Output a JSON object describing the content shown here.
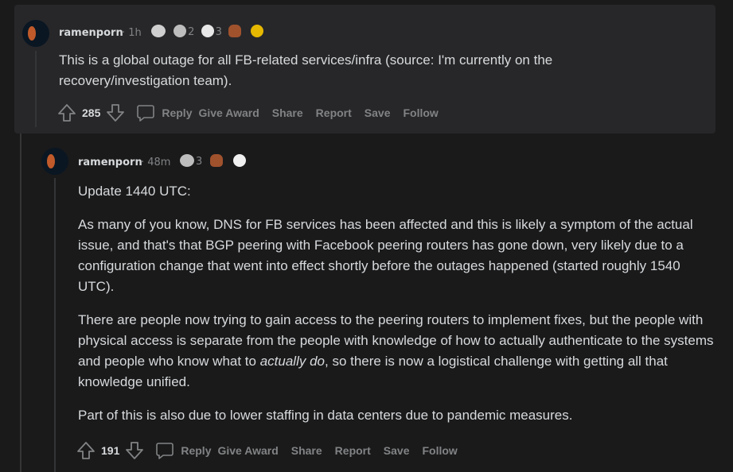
{
  "comment1": {
    "username": "ramenporn",
    "time": "1h",
    "awards": [
      {
        "icon": "silver-award-icon",
        "count": ""
      },
      {
        "icon": "wholesome-award-icon",
        "count": "2"
      },
      {
        "icon": "helpful-award-icon",
        "count": "3"
      },
      {
        "icon": "poop-award-icon",
        "count": ""
      },
      {
        "icon": "gold-award-icon",
        "count": ""
      }
    ],
    "body": "This is a global outage for all FB-related services/infra (source: I'm currently on the recovery/investigation team).",
    "score": "285",
    "actions": {
      "reply": "Reply",
      "give_award": "Give Award",
      "share": "Share",
      "report": "Report",
      "save": "Save",
      "follow": "Follow"
    }
  },
  "comment2": {
    "username": "ramenporn",
    "time": "48m",
    "awards": [
      {
        "icon": "wholesome-award-icon",
        "count": "3"
      },
      {
        "icon": "poop-award-icon",
        "count": ""
      },
      {
        "icon": "snoo-award-icon",
        "count": ""
      }
    ],
    "paragraphs": {
      "p1": "Update 1440 UTC:",
      "p2": "As many of you know, DNS for FB services has been affected and this is likely a symptom of the actual issue, and that's that BGP peering with Facebook peering routers has gone down, very likely due to a configuration change that went into effect shortly before the outages happened (started roughly 1540 UTC).",
      "p3_before": "There are people now trying to gain access to the peering routers to implement fixes, but the people with physical access is separate from the people with knowledge of how to actually authenticate to the systems and people who know what to ",
      "p3_em": "actually do",
      "p3_after": ", so there is now a logistical challenge with getting all that knowledge unified.",
      "p4": "Part of this is also due to lower staffing in data centers due to pandemic measures."
    },
    "score": "191",
    "actions": {
      "reply": "Reply",
      "give_award": "Give Award",
      "share": "Share",
      "report": "Report",
      "save": "Save",
      "follow": "Follow"
    }
  },
  "colors": {
    "background": "#1a1a1b",
    "card": "#272729",
    "text": "#d7dadc",
    "meta": "#818384"
  }
}
